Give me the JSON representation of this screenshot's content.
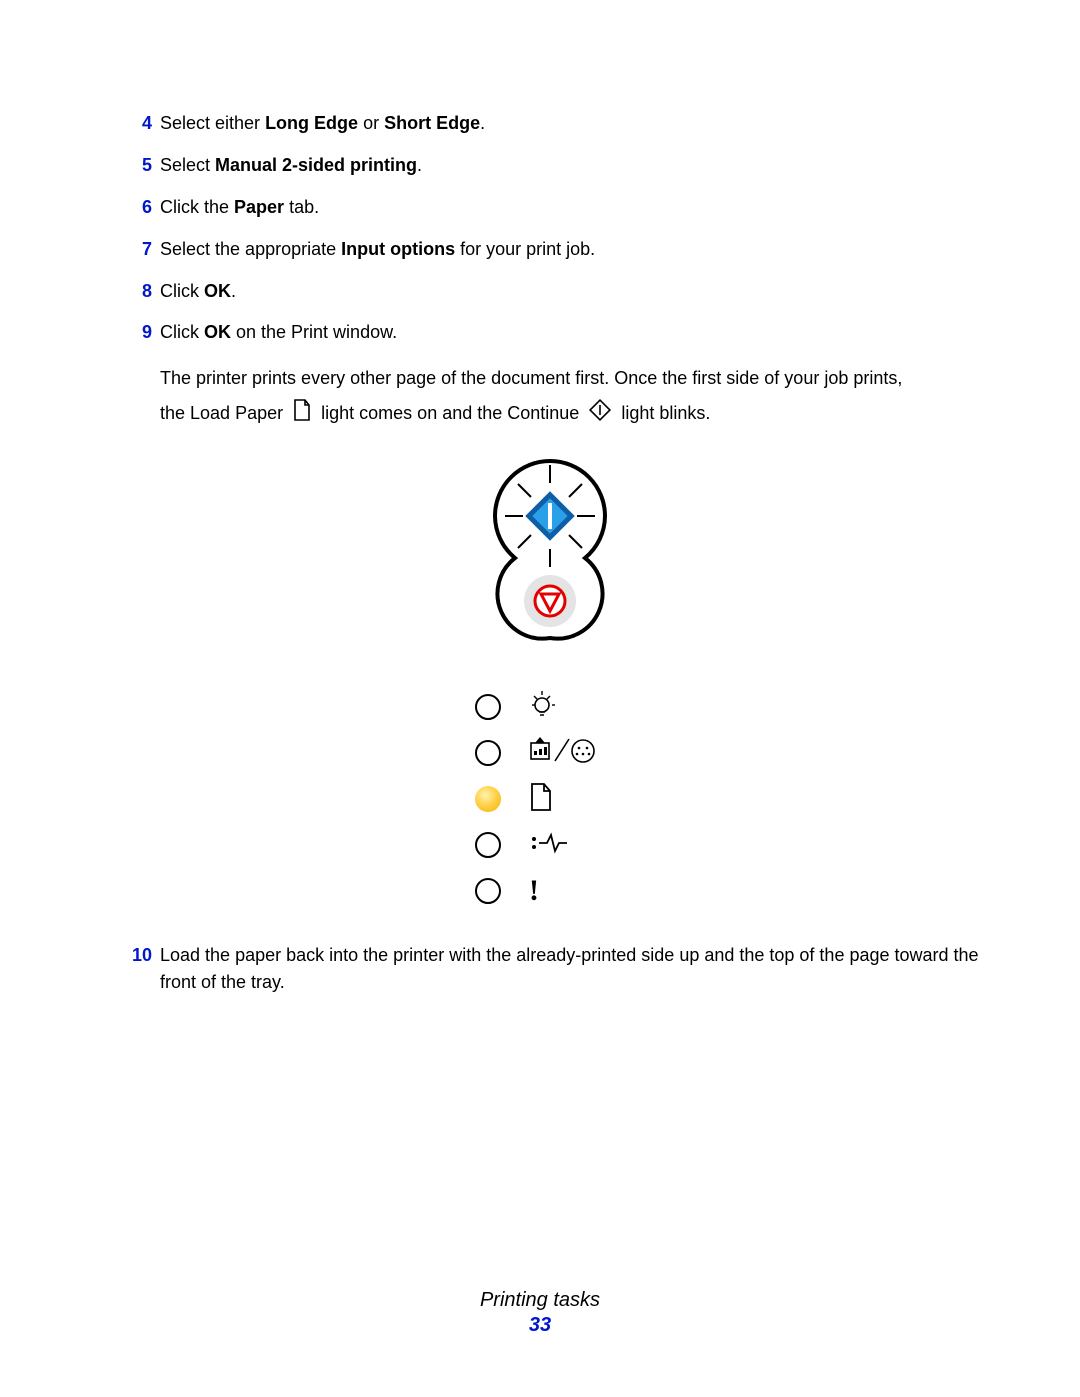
{
  "steps": [
    {
      "num": "4",
      "html": "Select either <b>Long Edge</b> or <b>Short Edge</b>."
    },
    {
      "num": "5",
      "html": "Select <b>Manual 2-sided printing</b>."
    },
    {
      "num": "6",
      "html": "Click the <b>Paper</b> tab."
    },
    {
      "num": "7",
      "html": "Select the appropriate <b>Input options</b> for your print job."
    },
    {
      "num": "8",
      "html": "Click <b>OK</b>."
    },
    {
      "num": "9",
      "html": "Click <b>OK</b> on the Print window."
    }
  ],
  "step9_extra": {
    "line1": "The printer prints every other page of the document first. Once the first side of your job prints,",
    "pre_icon1": "the Load Paper",
    "mid1": " light comes on and the Continue ",
    "post": " light blinks."
  },
  "step10": {
    "num": "10",
    "text": "Load the paper back into the printer with the already-printed side up and the top of the page toward the front of the tray."
  },
  "footer": {
    "title": "Printing tasks",
    "page": "33"
  },
  "indicators": [
    {
      "on": false,
      "icon": "bulb"
    },
    {
      "on": false,
      "icon": "toner"
    },
    {
      "on": true,
      "icon": "paper"
    },
    {
      "on": false,
      "icon": "jam"
    },
    {
      "on": false,
      "icon": "error"
    }
  ]
}
